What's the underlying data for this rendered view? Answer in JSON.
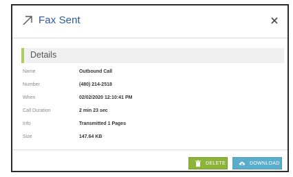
{
  "modal": {
    "title": "Fax Sent",
    "section_title": "Details"
  },
  "details": [
    {
      "label": "Name",
      "value": "Outbound Call"
    },
    {
      "label": "Number",
      "value": "(480) 214-2518"
    },
    {
      "label": "When",
      "value": "02/02/2020 12:10:41 PM"
    },
    {
      "label": "Call Duration",
      "value": "2 min 23 sec"
    },
    {
      "label": "Info",
      "value": "Transmitted 1 Pages"
    },
    {
      "label": "Size",
      "value": "147.64 KB"
    }
  ],
  "buttons": {
    "delete_label": "DELETE",
    "download_label": "DOWNLOAD"
  },
  "icons": {
    "header": "arrow-up-right-icon",
    "close": "close-icon",
    "delete": "trash-icon",
    "download": "cloud-download-icon"
  },
  "colors": {
    "title": "#2c5aa0",
    "accent_bar": "#a9cf5a",
    "delete_button": "#8db43a",
    "download_button": "#5aaecc"
  }
}
